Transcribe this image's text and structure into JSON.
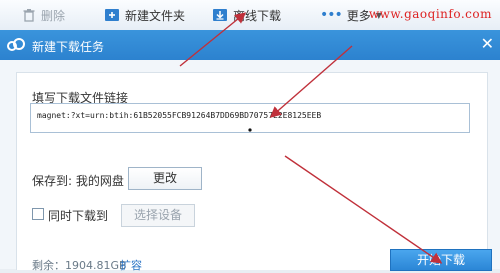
{
  "toolbar": {
    "delete_label": "删除",
    "new_folder_label": "新建文件夹",
    "offline_download_label": "离线下载",
    "more_label": "更多"
  },
  "watermark": "www.gaoqinfo.com",
  "dialog": {
    "title": "新建下载任务",
    "link_label": "填写下载文件链接",
    "link_value": "magnet:?xt=urn:btih:61B52055FCB91264B7DD69BD70757E2E8125EEB",
    "save_to_label": "保存到: 我的网盘",
    "change_button": "更改",
    "sync_download_label": "同时下载到",
    "select_device_button": "选择设备",
    "quota_text": "剩余：1904.81GB",
    "expand_link": "扩容",
    "start_button": "开始下载"
  },
  "colors": {
    "titlebar": "#2c82cf",
    "arrow": "#c0303a",
    "watermark": "#d22222"
  }
}
